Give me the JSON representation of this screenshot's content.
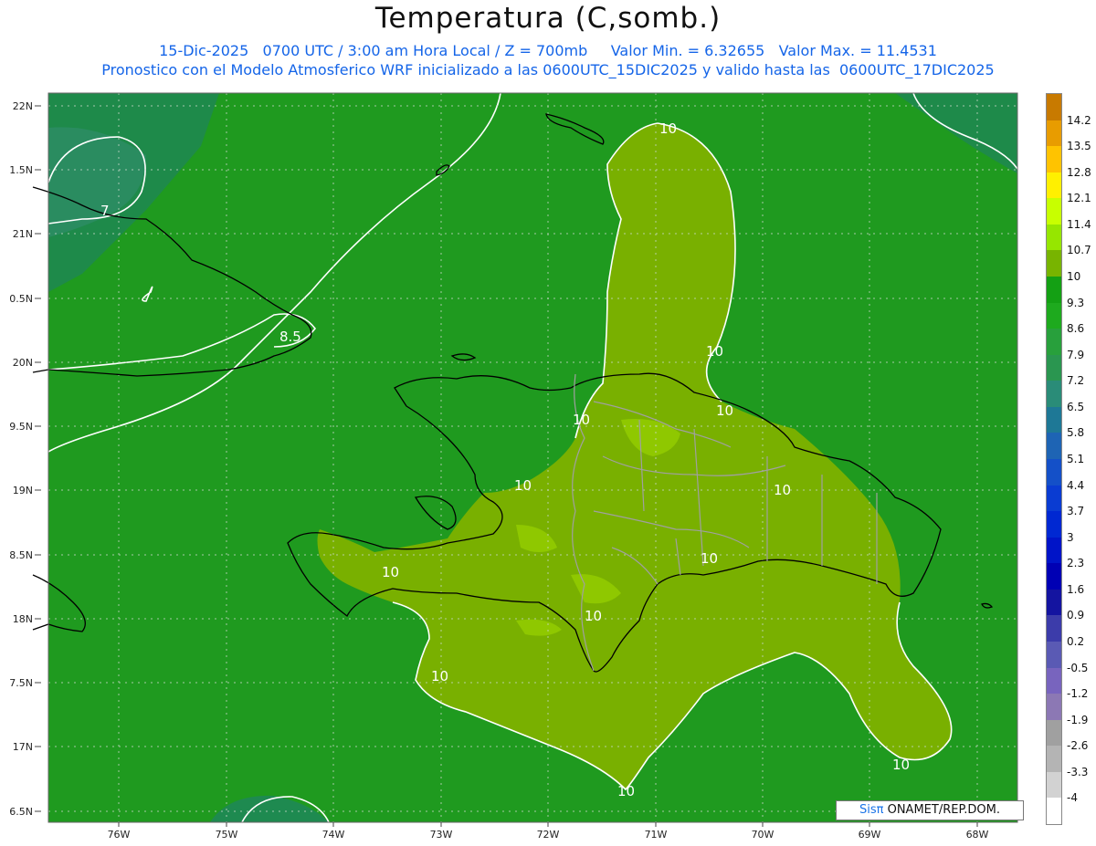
{
  "title": "Temperatura (C,somb.)",
  "subtitle_line1": "15-Dic-2025   0700 UTC / 3:00 am Hora Local / Z = 700mb     Valor Min. = 6.32655   Valor Max. = 11.4531",
  "subtitle_line2": "Pronostico con el Modelo Atmosferico WRF inicializado a las 0600UTC_15DIC2025 y valido hasta las  0600UTC_17DIC2025",
  "colorbar": {
    "labels": [
      "14.2",
      "13.5",
      "12.8",
      "12.1",
      "11.4",
      "10.7",
      "10",
      "9.3",
      "8.6",
      "7.9",
      "7.2",
      "6.5",
      "5.8",
      "5.1",
      "4.4",
      "3.7",
      "3",
      "2.3",
      "1.6",
      "0.9",
      "0.2",
      "-0.5",
      "-1.2",
      "-1.9",
      "-2.6",
      "-3.3",
      "-4"
    ],
    "colors": [
      "#c87a00",
      "#e89c00",
      "#ffc300",
      "#fff000",
      "#c8ff00",
      "#96e600",
      "#78b400",
      "#14a014",
      "#1eaa1e",
      "#28a03c",
      "#2a9650",
      "#2a8c78",
      "#1e7896",
      "#1e64b4",
      "#1450c8",
      "#0a3cd2",
      "#0028d2",
      "#0014c8",
      "#0000b4",
      "#1414a0",
      "#3c3caa",
      "#5a5ab4",
      "#7864be",
      "#8c78b4",
      "#a0a0a0",
      "#b4b4b4",
      "#d2d2d2",
      "#ffffff"
    ]
  },
  "x_ticks": [
    "76W",
    "75W",
    "74W",
    "73W",
    "72W",
    "71W",
    "70W",
    "69W",
    "68W"
  ],
  "y_ticks": [
    "22N",
    "1.5N",
    "21N",
    "0.5N",
    "20N",
    "9.5N",
    "19N",
    "8.5N",
    "18N",
    "7.5N",
    "17N",
    "6.5N"
  ],
  "contour_labels": [
    "10",
    "10",
    "10",
    "10",
    "10",
    "10",
    "10",
    "10",
    "10",
    "10",
    "10",
    "8.5",
    "7"
  ],
  "credit": {
    "logo": "Sisπ",
    "text": " ONAMET/REP.DOM."
  },
  "colors": {
    "ocean_base": "#1f9a1f",
    "dark_region": "#1e8a4a",
    "light_region": "#79b000",
    "contour": "#ffffff",
    "coast": "#000000",
    "border": "#a0a0a0"
  }
}
